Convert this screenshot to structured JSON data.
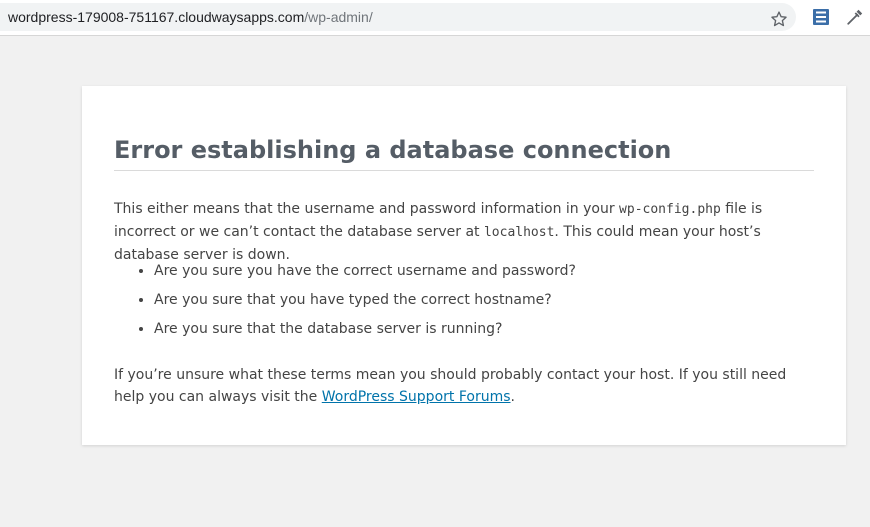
{
  "browser": {
    "url_host": "wordpress-179008-751167.cloudwaysapps.com",
    "url_path": "/wp-admin/"
  },
  "error": {
    "title": "Error establishing a database connection",
    "para1": {
      "before_code1": "This either means that the username and password information in your ",
      "code1": "wp-config.php",
      "after_code1": " file is incorrect or we can’t contact the database server at ",
      "code2": "localhost",
      "after_code2": ". This could mean your host’s database server is down."
    },
    "questions": [
      "Are you sure you have the correct username and password?",
      "Are you sure that you have typed the correct hostname?",
      "Are you sure that the database server is running?"
    ],
    "para2": {
      "before_link": "If you’re unsure what these terms mean you should probably contact your host. If you still need help you can always visit the ",
      "link_text": "WordPress Support Forums",
      "after_link": "."
    }
  },
  "icons": [
    "star-icon",
    "extension-icon",
    "eyedropper-icon"
  ],
  "colors": {
    "page_bg": "#f1f1f1",
    "card_bg": "#ffffff",
    "title": "#555d66",
    "link": "#0073aa"
  }
}
